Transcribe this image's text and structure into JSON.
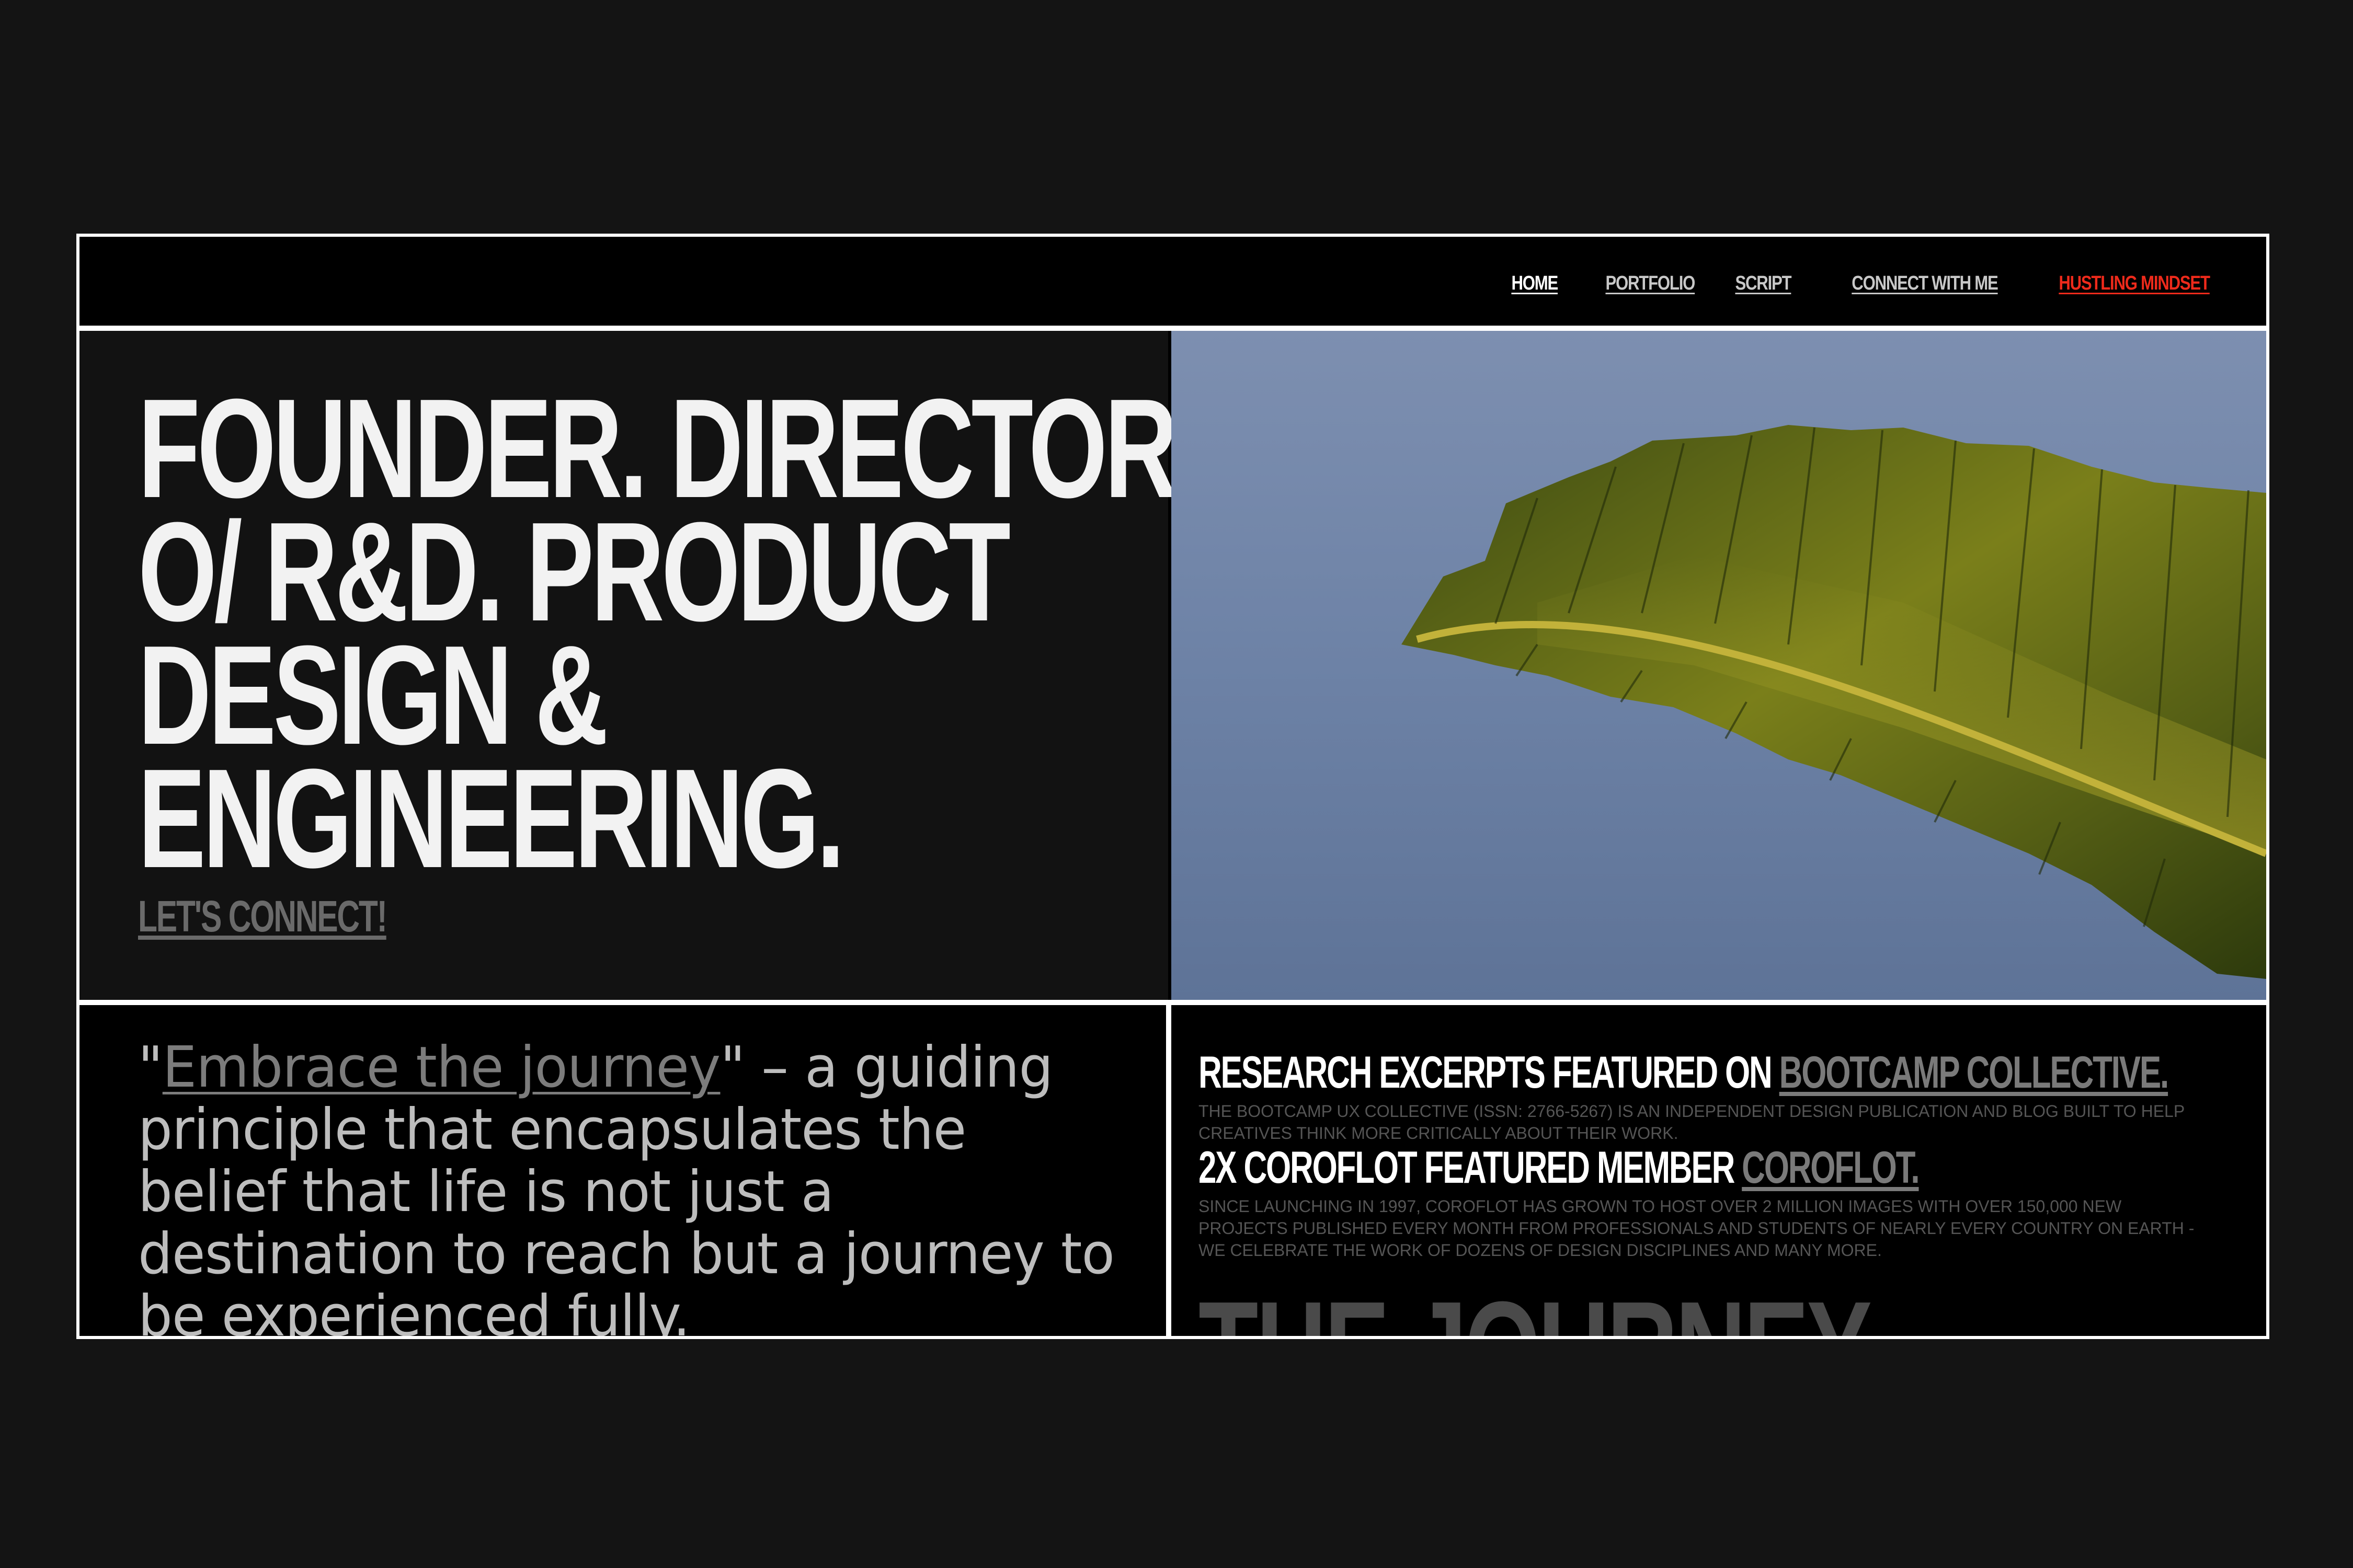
{
  "nav": {
    "items": [
      {
        "label": "HOME"
      },
      {
        "label": "PORTFOLIO"
      },
      {
        "label": "SCRIPT"
      },
      {
        "label": "CONNECT WITH ME"
      },
      {
        "label": "HUSTLING MINDSET"
      }
    ],
    "active_color": "#ffffff",
    "highlight_color": "#ee2a1b"
  },
  "hero": {
    "headline_lines": [
      "FOUNDER. DIRECTOR",
      "O/ R&D. PRODUCT",
      "DESIGN &",
      "ENGINEERING."
    ],
    "cta_label": "LET'S CONNECT!",
    "image_icon": "banana-leaf-photo"
  },
  "quote": {
    "open_mark": "\"",
    "link_text": "Embrace the journey",
    "close_mark": "\"",
    "body": " – a guiding principle that encapsulates the belief that life is not just a destination to reach but a journey to be experienced fully."
  },
  "features": {
    "research": {
      "title": "RESEARCH EXCERPTS FEATURED ON ",
      "link": "BOOTCAMP COLLECTIVE.",
      "desc": "THE BOOTCAMP UX COLLECTIVE (ISSN: 2766-5267) IS AN INDEPENDENT DESIGN PUBLICATION AND BLOG BUILT TO HELP CREATIVES THINK MORE CRITICALLY ABOUT THEIR WORK."
    },
    "coroflot": {
      "title": "2X COROFLOT FEATURED MEMBER ",
      "link": "COROFLOT.",
      "desc": "SINCE LAUNCHING IN 1997, COROFLOT HAS GROWN TO HOST OVER 2 MILLION IMAGES WITH OVER 150,000 NEW PROJECTS PUBLISHED EVERY MONTH FROM PROFESSIONALS AND STUDENTS OF NEARLY EVERY COUNTRY ON EARTH - WE CELEBRATE THE WORK OF DOZENS OF DESIGN DISCIPLINES AND MANY MORE."
    },
    "journey_heading": "THE JOURNEY"
  }
}
